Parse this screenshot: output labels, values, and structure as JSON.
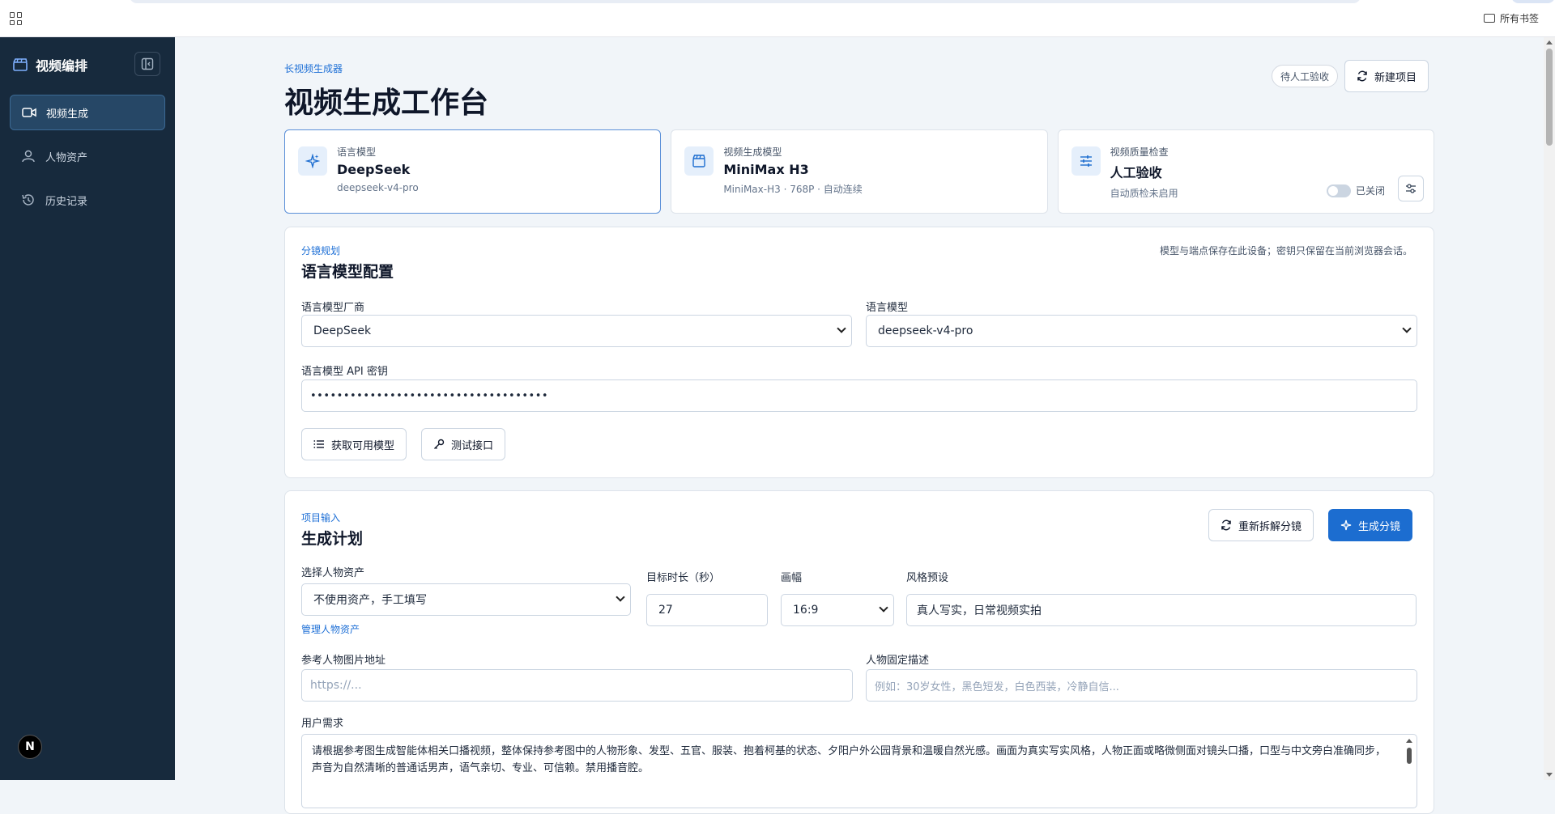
{
  "browser": {
    "bookmarks_label": "所有书签"
  },
  "sidebar": {
    "brand": "视频编排",
    "items": [
      {
        "label": "视频生成",
        "icon": "video-camera-icon",
        "active": true
      },
      {
        "label": "人物资产",
        "icon": "user-icon",
        "active": false
      },
      {
        "label": "历史记录",
        "icon": "history-icon",
        "active": false
      }
    ],
    "avatar_letter": "N"
  },
  "header": {
    "eyebrow": "长视频生成器",
    "title": "视频生成工作台",
    "status_badge": "待人工验收",
    "new_project_label": "新建项目"
  },
  "cards": [
    {
      "label": "语言模型",
      "title": "DeepSeek",
      "subtitle": "deepseek-v4-pro",
      "icon": "sparkles-icon"
    },
    {
      "label": "视频生成模型",
      "title": "MiniMax H3",
      "subtitle": "MiniMax-H3 · 768P · 自动连续",
      "icon": "clapperboard-icon"
    },
    {
      "label": "视频质量检查",
      "title": "人工验收",
      "subtitle": "自动质检未启用",
      "icon": "sliders-icon",
      "toggle_label": "已关闭",
      "toggle_on": false
    }
  ],
  "llm_config": {
    "eyebrow": "分镜规划",
    "title": "语言模型配置",
    "note": "模型与端点保存在此设备；密钥只保留在当前浏览器会话。",
    "vendor_label": "语言模型厂商",
    "vendor_value": "DeepSeek",
    "model_label": "语言模型",
    "model_value": "deepseek-v4-pro",
    "api_key_label": "语言模型 API 密钥",
    "api_key_value": "••••••••••••••••••••••••••••••••••••",
    "fetch_models_label": "获取可用模型",
    "test_api_label": "测试接口"
  },
  "plan": {
    "eyebrow": "项目输入",
    "title": "生成计划",
    "resplit_label": "重新拆解分镜",
    "generate_label": "生成分镜",
    "character_asset_label": "选择人物资产",
    "character_asset_value": "不使用资产，手工填写",
    "manage_assets_link": "管理人物资产",
    "duration_label": "目标时长（秒）",
    "duration_value": "27",
    "aspect_label": "画幅",
    "aspect_value": "16:9",
    "style_label": "风格预设",
    "style_value": "真人写实，日常视频实拍",
    "ref_image_label": "参考人物图片地址",
    "ref_image_placeholder": "https://...",
    "character_desc_label": "人物固定描述",
    "character_desc_placeholder": "例如：30岁女性，黑色短发，白色西装，冷静自信...",
    "user_request_label": "用户需求",
    "user_request_value": "请根据参考图生成智能体相关口播视频，整体保持参考图中的人物形象、发型、五官、服装、抱着柯基的状态、夕阳户外公园背景和温暖自然光感。画面为真实写实风格，人物正面或略微侧面对镜头口播，口型与中文旁白准确同步，声音为自然清晰的普通话男声，语气亲切、专业、可信赖。禁用播音腔。"
  },
  "colors": {
    "sidebar_bg": "#172a3d",
    "accent": "#1c6dd0",
    "page_bg": "#f1f5f9"
  }
}
